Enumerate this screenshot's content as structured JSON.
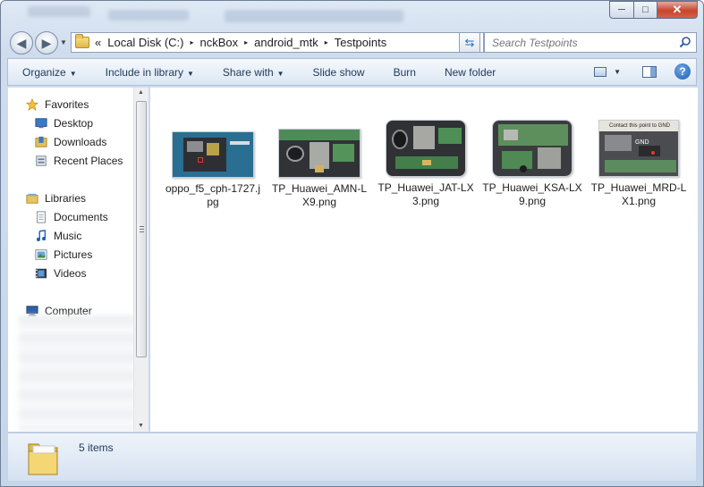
{
  "window": {
    "caption_min": "─",
    "caption_max": "□",
    "caption_close": "✕"
  },
  "address": {
    "prefix": "«",
    "crumbs": [
      "Local Disk (C:)",
      "nckBox",
      "android_mtk",
      "Testpoints"
    ],
    "separator": "▸"
  },
  "search": {
    "placeholder": "Search Testpoints"
  },
  "commands": {
    "organize": "Organize",
    "include": "Include in library",
    "share": "Share with",
    "slideshow": "Slide show",
    "burn": "Burn",
    "newfolder": "New folder"
  },
  "sidebar": {
    "favorites": "Favorites",
    "desktop": "Desktop",
    "downloads": "Downloads",
    "recent": "Recent Places",
    "libraries": "Libraries",
    "documents": "Documents",
    "music": "Music",
    "pictures": "Pictures",
    "videos": "Videos",
    "computer": "Computer"
  },
  "files": [
    {
      "name": "oppo_f5_cph-1727.jpg"
    },
    {
      "name": "TP_Huawei_AMN-LX9.png"
    },
    {
      "name": "TP_Huawei_JAT-LX3.png"
    },
    {
      "name": "TP_Huawei_KSA-LX9.png"
    },
    {
      "name": "TP_Huawei_MRD-LX1.png",
      "overlay_text": "Contact this point to GND",
      "overlay_label": "GND"
    }
  ],
  "status": {
    "count": "5 items"
  }
}
